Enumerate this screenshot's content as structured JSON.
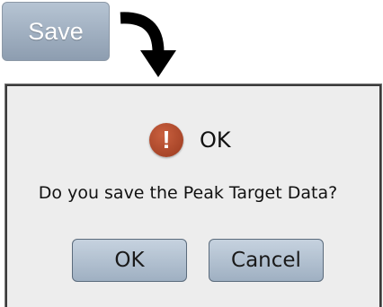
{
  "top_button": {
    "label": "Save"
  },
  "dialog": {
    "title": "OK",
    "icon": "warning-exclamation",
    "message": "Do you save the Peak Target Data?",
    "ok_label": "OK",
    "cancel_label": "Cancel"
  },
  "colors": {
    "button_top": "#b6c4d3",
    "button_bottom": "#8d9db0",
    "dialog_bg": "#ededed",
    "icon_red": "#a8432a"
  }
}
